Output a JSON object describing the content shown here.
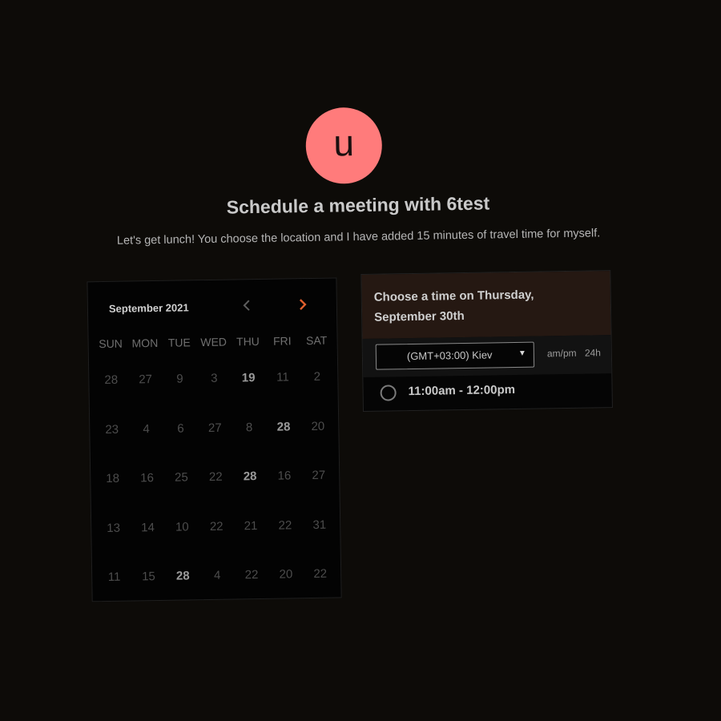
{
  "host": {
    "avatar_initial": "u",
    "title": "Schedule a meeting with 6test",
    "description": "Let's get lunch! You choose the location and I have added 15 minutes of travel time for myself."
  },
  "calendar": {
    "month_label": "September 2021",
    "prev_icon": "chevron-left-icon",
    "next_icon": "chevron-right-icon",
    "weekdays": [
      "SUN",
      "MON",
      "TUE",
      "WED",
      "THU",
      "FRI",
      "SAT"
    ],
    "weeks": [
      [
        "28",
        "27",
        "9",
        "3",
        "19",
        "11",
        "2"
      ],
      [
        "23",
        "4",
        "6",
        "27",
        "8",
        "28",
        "20"
      ],
      [
        "18",
        "16",
        "25",
        "22",
        "28",
        "16",
        "27"
      ],
      [
        "13",
        "14",
        "10",
        "22",
        "21",
        "22",
        "31"
      ],
      [
        "11",
        "15",
        "28",
        "4",
        "22",
        "20",
        "22"
      ]
    ],
    "bold_days": [
      [
        0,
        4
      ],
      [
        1,
        5
      ],
      [
        2,
        4
      ],
      [
        4,
        2
      ]
    ]
  },
  "time_panel": {
    "heading": "Choose a time on Thursday, September 30th",
    "timezone": "(GMT+03:00) Kiev",
    "format_ampm": "am/pm",
    "format_24h": "24h",
    "slots": [
      "11:00am - 12:00pm"
    ]
  },
  "colors": {
    "background": "#0d0b08",
    "avatar": "#ff7b7b",
    "accent": "#e0602e",
    "header_bg": "#251812"
  }
}
